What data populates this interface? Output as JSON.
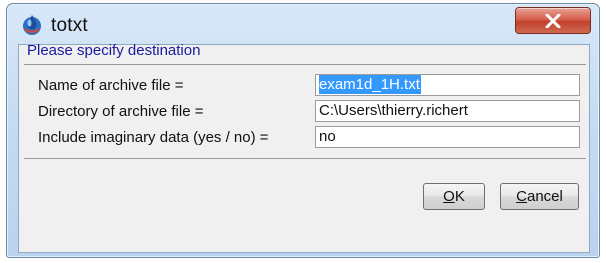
{
  "window": {
    "title": "totxt"
  },
  "dialog": {
    "heading": "Please specify destination",
    "fields": [
      {
        "label": "Name of archive file =",
        "value": "exam1d_1H.txt",
        "selected": true
      },
      {
        "label": "Directory of archive file =",
        "value": "C:\\Users\\thierry.richert",
        "selected": false
      },
      {
        "label": "Include imaginary data (yes / no) =",
        "value": "no",
        "selected": false
      }
    ]
  },
  "buttons": {
    "ok": {
      "mnemonic": "O",
      "rest": "K"
    },
    "cancel": {
      "mnemonic": "C",
      "rest": "ancel"
    }
  },
  "icons": {
    "app": "topspin-drop-icon",
    "close": "close-icon"
  },
  "colors": {
    "heading": "#1a1aa0",
    "selection": "#3399ff",
    "close_button": "#c2412c"
  }
}
